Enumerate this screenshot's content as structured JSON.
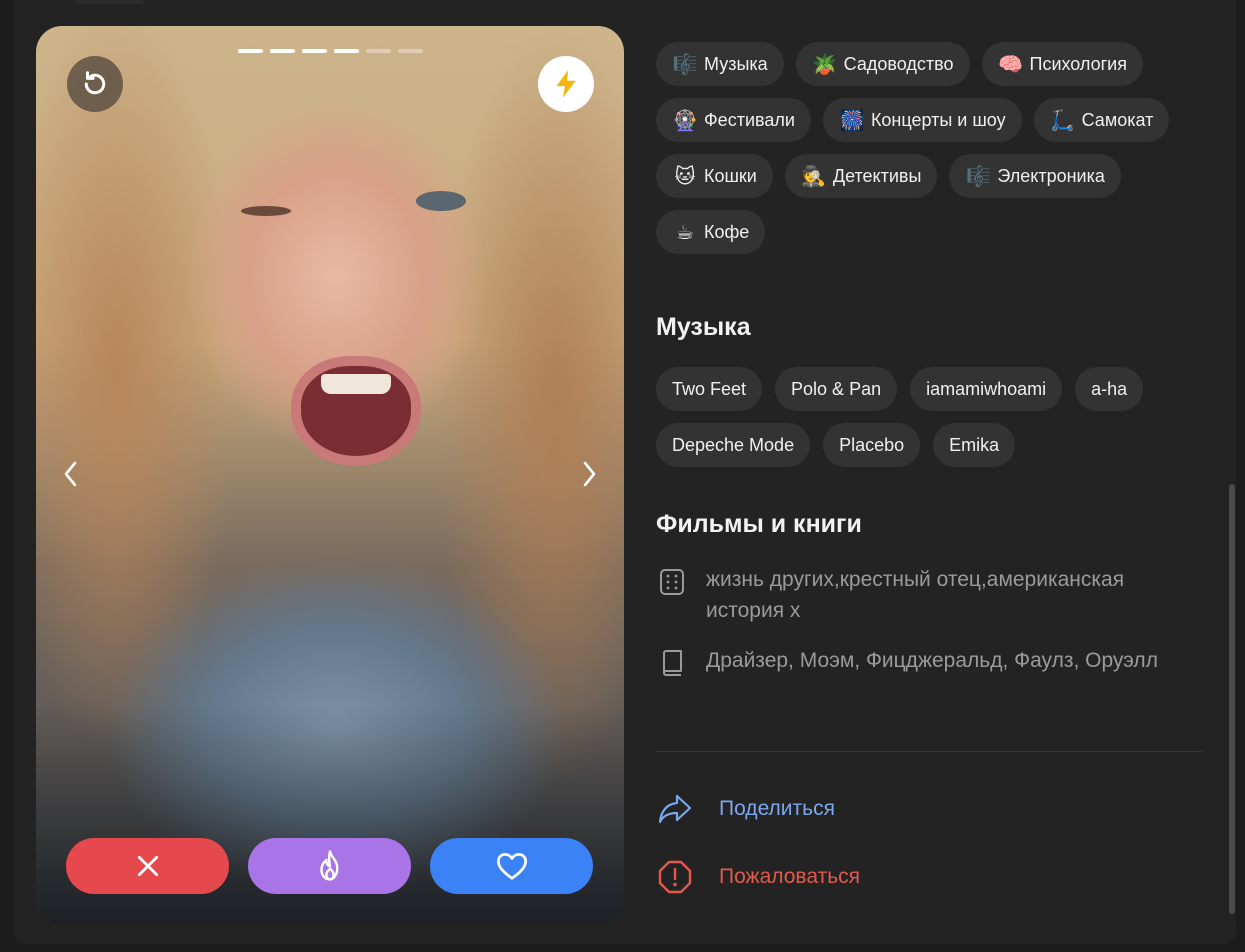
{
  "photo": {
    "progress_total": 6,
    "progress_active": 4
  },
  "interests": [
    {
      "icon": "music-notes-icon",
      "glyph": "🎼",
      "label": "Музыка"
    },
    {
      "icon": "potted-plant-icon",
      "glyph": "🪴",
      "label": "Садоводство"
    },
    {
      "icon": "brain-icon",
      "glyph": "🧠",
      "label": "Психология"
    },
    {
      "icon": "ferris-wheel-icon",
      "glyph": "🎡",
      "label": "Фестивали"
    },
    {
      "icon": "fireworks-icon",
      "glyph": "🎆",
      "label": "Концерты и шоу"
    },
    {
      "icon": "kick-scooter-icon",
      "glyph": "🛴",
      "label": "Самокат"
    },
    {
      "icon": "cat-face-icon",
      "glyph": "🐱",
      "label": "Кошки"
    },
    {
      "icon": "detective-icon",
      "glyph": "🕵",
      "label": "Детективы"
    },
    {
      "icon": "music-notes-icon",
      "glyph": "🎼",
      "label": "Электроника"
    },
    {
      "icon": "coffee-icon",
      "glyph": "☕",
      "label": "Кофе"
    }
  ],
  "music": {
    "title": "Музыка",
    "artists": [
      "Two Feet",
      "Polo & Pan",
      "iamamiwhoami",
      "a-ha",
      "Depeche Mode",
      "Placebo",
      "Emika"
    ]
  },
  "films_books": {
    "title": "Фильмы и книги",
    "films": "жизнь других,крестный отец,американская история х",
    "books": "Драйзер, Моэм, Фицджеральд, Фаулз, Оруэлл"
  },
  "actions": {
    "share": "Поделиться",
    "report": "Пожаловаться"
  },
  "colors": {
    "dislike": "#e5484d",
    "superlike": "#a974e6",
    "like": "#3b82f6",
    "share": "#7aa7ee",
    "report": "#e5584d",
    "boost": "#f5b50a"
  }
}
